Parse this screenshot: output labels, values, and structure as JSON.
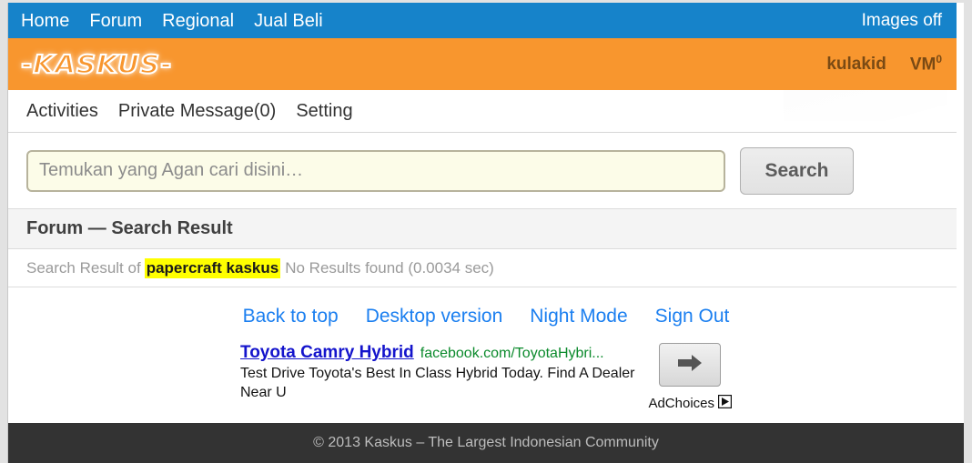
{
  "topnav": {
    "links": [
      {
        "label": "Home"
      },
      {
        "label": "Forum"
      },
      {
        "label": "Regional"
      },
      {
        "label": "Jual Beli"
      }
    ],
    "images_toggle": "Images off",
    "background_color": "#1683ca"
  },
  "brandbar": {
    "logo_text": "KASKUS",
    "logo_dash": "-",
    "username": "kulakid",
    "vm_label": "VM",
    "vm_count": "0",
    "background_color": "#f8962e"
  },
  "usernav": {
    "items": [
      {
        "label": "Activities"
      },
      {
        "label": "Private Message(0)"
      },
      {
        "label": "Setting"
      }
    ]
  },
  "search": {
    "placeholder": "Temukan yang Agan cari disini…",
    "value": "",
    "button_label": "Search"
  },
  "section": {
    "title": "Forum — Search Result"
  },
  "result": {
    "prefix": "Search Result of",
    "keyword": "papercraft kaskus",
    "suffix": "No Results found (0.0034 sec)",
    "highlight_color": "#ffff00"
  },
  "footer_links": [
    {
      "label": "Back to top"
    },
    {
      "label": "Desktop version"
    },
    {
      "label": "Night Mode"
    },
    {
      "label": "Sign Out"
    }
  ],
  "ad": {
    "title": "Toyota Camry Hybrid",
    "url": "facebook.com/ToyotaHybri...",
    "description": "Test Drive Toyota's Best In Class Hybrid Today. Find A Dealer Near U",
    "cta_icon": "arrow-right-icon",
    "adchoices_label": "AdChoices",
    "adchoices_icon": "adchoices-triangle-icon"
  },
  "copyright": {
    "text": "© 2013 Kaskus – The Largest Indonesian Community"
  }
}
